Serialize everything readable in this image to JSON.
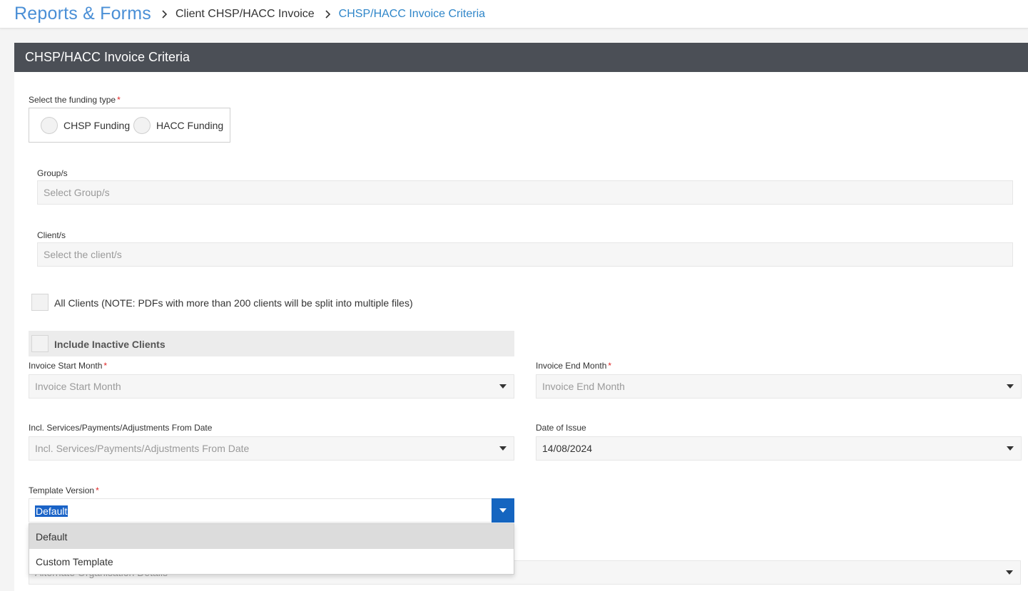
{
  "breadcrumb": {
    "root": "Reports & Forms",
    "middle": "Client CHSP/HACC Invoice",
    "current": "CHSP/HACC Invoice Criteria"
  },
  "panel": {
    "title": "CHSP/HACC Invoice Criteria"
  },
  "funding": {
    "label": "Select the funding type",
    "required": "*",
    "options": [
      "CHSP Funding",
      "HACC Funding"
    ]
  },
  "groups": {
    "label": "Group/s",
    "placeholder": "Select Group/s"
  },
  "clients": {
    "label": "Client/s",
    "placeholder": "Select the client/s"
  },
  "all_clients": {
    "label": "All Clients (NOTE: PDFs with more than 200 clients will be split into multiple files)",
    "checked": false
  },
  "include_inactive": {
    "label": "Include Inactive Clients",
    "checked": false
  },
  "invoice_start": {
    "label": "Invoice Start Month",
    "required": "*",
    "placeholder": "Invoice Start Month"
  },
  "invoice_end": {
    "label": "Invoice End Month",
    "required": "*",
    "placeholder": "Invoice End Month"
  },
  "from_date": {
    "label": "Incl. Services/Payments/Adjustments From Date",
    "placeholder": "Incl. Services/Payments/Adjustments From Date"
  },
  "date_of_issue": {
    "label": "Date of Issue",
    "value": "14/08/2024"
  },
  "template": {
    "label": "Template Version",
    "required": "*",
    "value": "Default",
    "options": [
      "Default",
      "Custom Template"
    ]
  },
  "alternate_org": {
    "placeholder": "Alternate Organisation Details"
  },
  "colors": {
    "accent": "#4a8fd6",
    "header_bg": "#4b4f56",
    "selected_blue": "#1565c0",
    "required_red": "#e02424"
  }
}
